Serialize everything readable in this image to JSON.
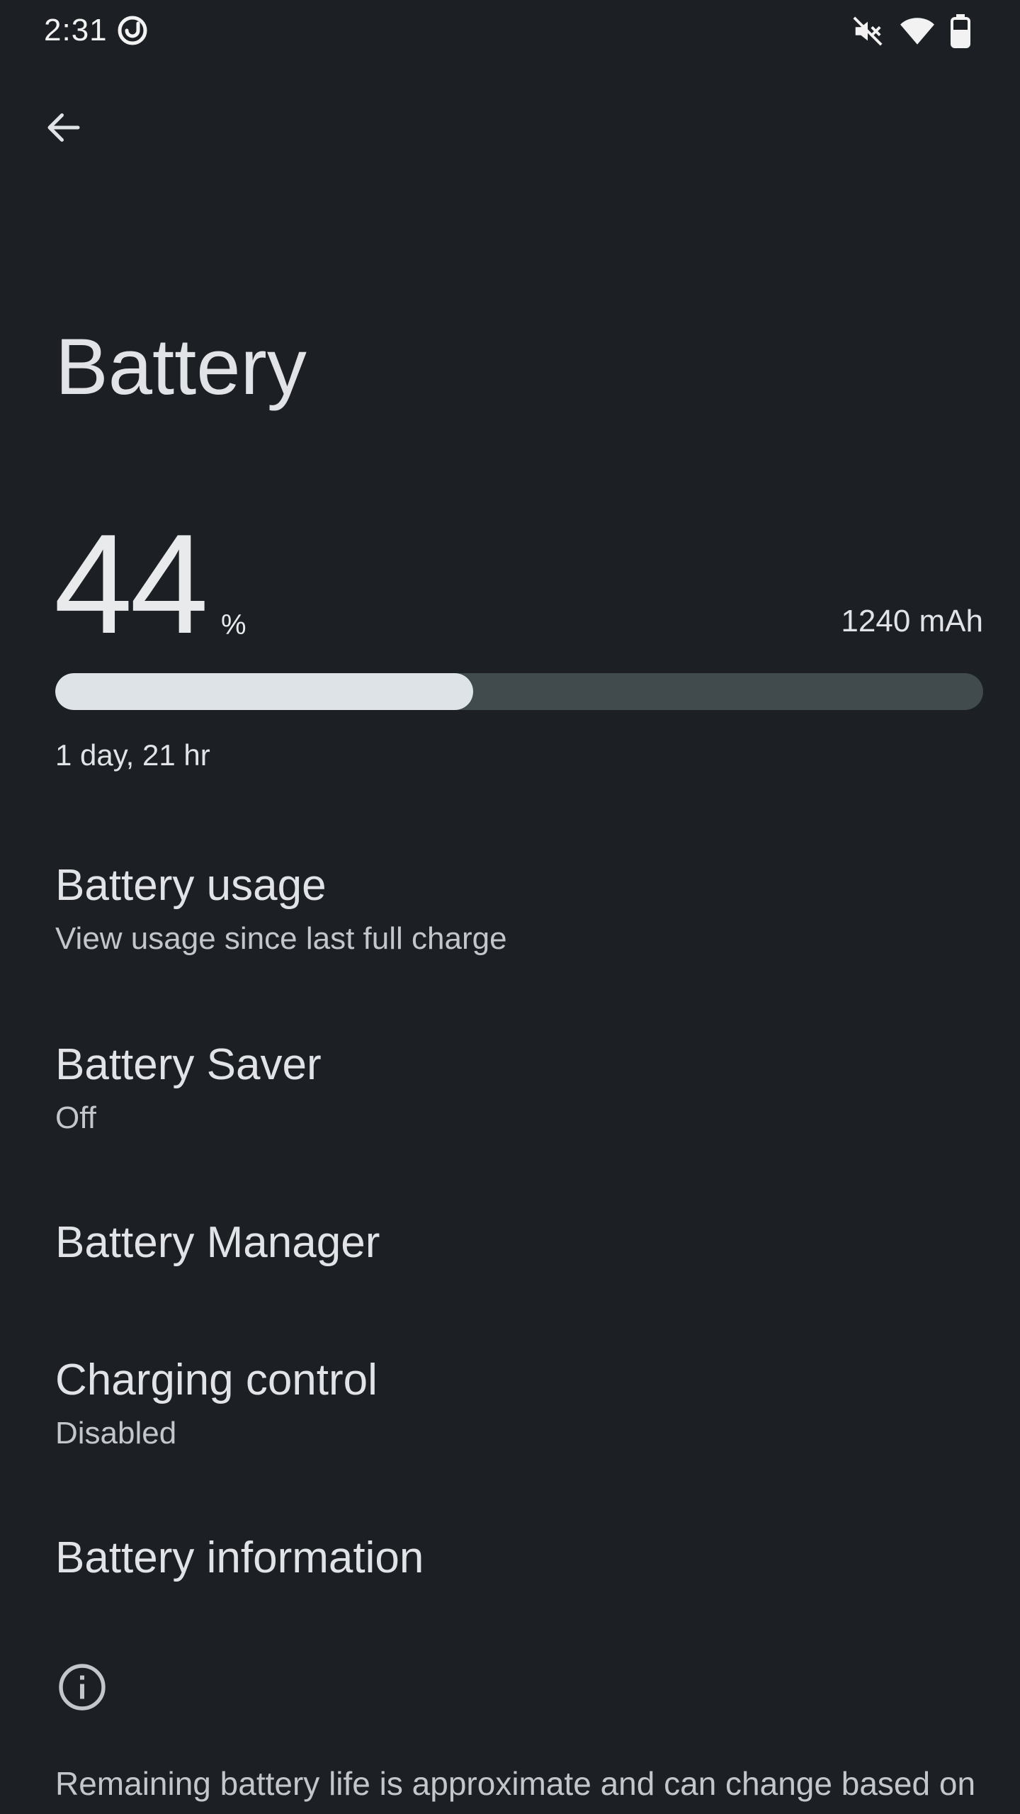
{
  "status_bar": {
    "time": "2:31",
    "icons": [
      "app-notification-icon",
      "mute-icon",
      "wifi-icon",
      "battery-icon"
    ]
  },
  "toolbar": {
    "back_icon": "arrow-back-icon"
  },
  "page": {
    "title": "Battery"
  },
  "battery": {
    "level": "44",
    "unit": "%",
    "level_fraction": 0.45,
    "capacity": "1240 mAh",
    "remaining": "1 day, 21 hr"
  },
  "preferences": [
    {
      "title": "Battery usage",
      "summary": "View usage since last full charge"
    },
    {
      "title": "Battery Saver",
      "summary": "Off"
    },
    {
      "title": "Battery Manager",
      "summary": ""
    },
    {
      "title": "Charging control",
      "summary": "Disabled"
    },
    {
      "title": "Battery information",
      "summary": ""
    }
  ],
  "footer": {
    "icon": "info-icon",
    "text": "Remaining battery life is approximate and can change based on"
  },
  "colors": {
    "background": "#1c2024",
    "progress_fill": "#dde3e7",
    "progress_track": "#414a4c",
    "text_primary": "#e2e3e6",
    "text_secondary": "#c3c7cb"
  }
}
